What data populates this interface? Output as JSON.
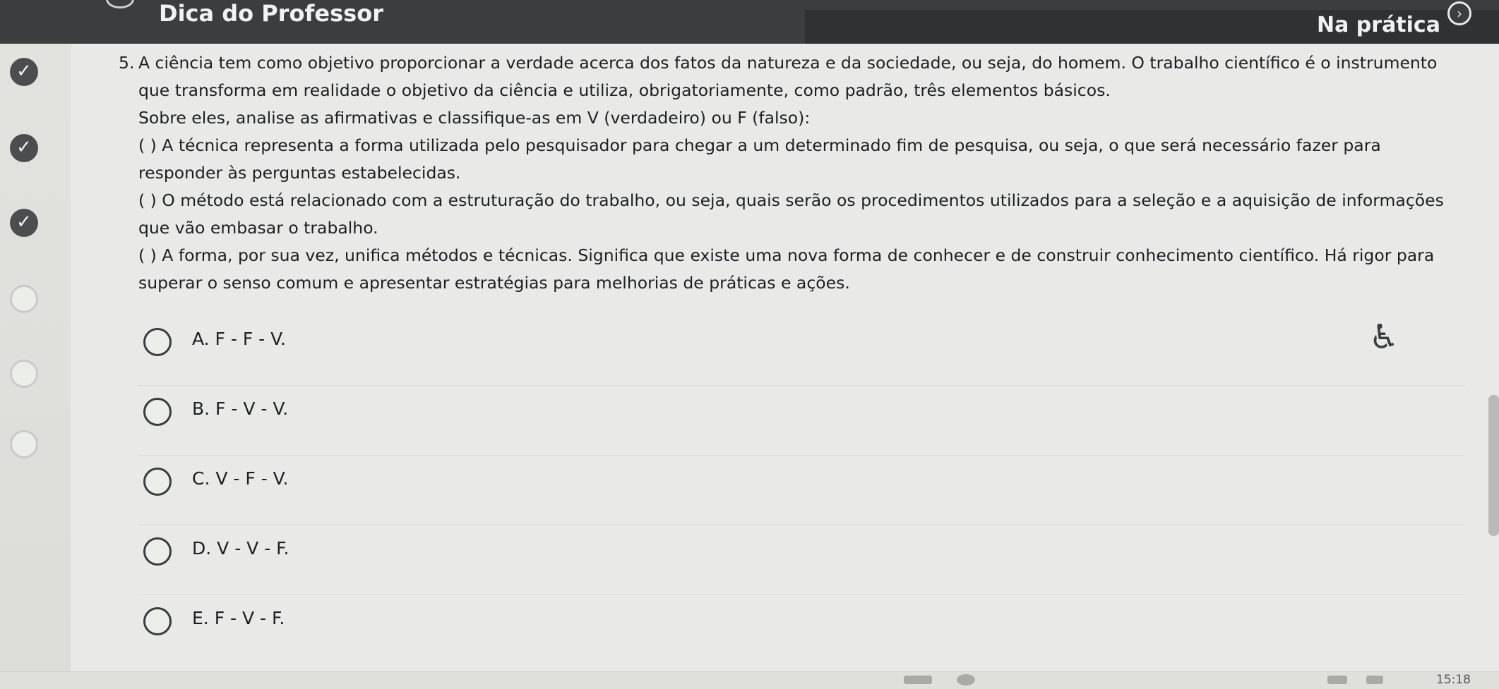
{
  "header": {
    "left_title": "Dica do Professor",
    "right_title": "Na prática",
    "nav_icon": "chevron-right-icon"
  },
  "sidebar": {
    "items": [
      {
        "state": "done"
      },
      {
        "state": "done"
      },
      {
        "state": "done"
      },
      {
        "state": "todo"
      },
      {
        "state": "todo"
      },
      {
        "state": "todo"
      }
    ]
  },
  "question": {
    "number": "5.",
    "line1": "A ciência tem como objetivo proporcionar a verdade acerca dos fatos da natureza e da sociedade, ou seja, do homem. O trabalho científico é o instrumento que transforma em realidade o objetivo da ciência e utiliza, obrigatoriamente, como padrão, três elementos básicos.",
    "line2": "Sobre eles, analise as afirmativas e classifique-as em V (verdadeiro) ou F (falso):",
    "statement1": "( ) A técnica representa a forma utilizada pelo pesquisador para chegar a um determinado fim de pesquisa, ou seja, o que será necessário fazer para responder às perguntas estabelecidas.",
    "statement2": "( ) O método está relacionado com a estruturação do trabalho, ou seja, quais serão os procedimentos utilizados para a seleção e a aquisição de informações que vão embasar o trabalho.",
    "statement3": "( ) A forma, por sua vez, unifica métodos e técnicas. Significa que existe uma nova forma de conhecer e de construir conhecimento científico. Há rigor para superar o senso comum e apresentar estratégias para melhorias de práticas e ações."
  },
  "options": [
    {
      "label": "A. F - F - V."
    },
    {
      "label": "B. F - V - V."
    },
    {
      "label": "C. V - F - V."
    },
    {
      "label": "D. V - V - F."
    },
    {
      "label": "E. F - V - F."
    }
  ],
  "taskbar": {
    "clock": "15:18"
  },
  "colors": {
    "topbar": "#3b3d3f",
    "background": "#e9eae7",
    "text": "#1c2023",
    "status_done": "#4b4d4f"
  }
}
